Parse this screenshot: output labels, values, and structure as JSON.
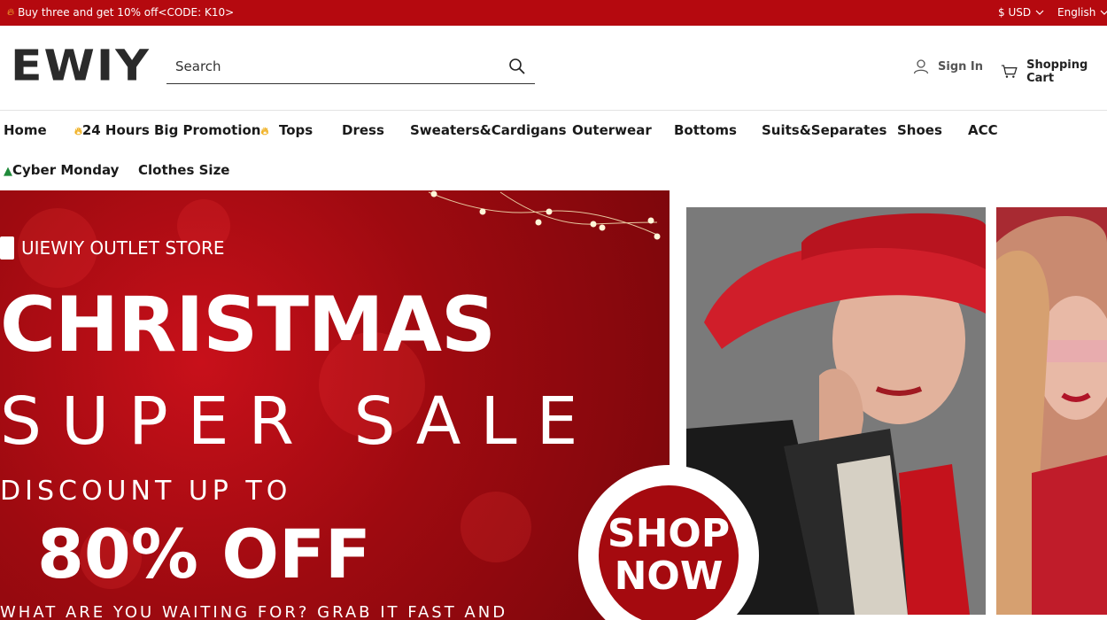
{
  "topbar": {
    "promo_text": "Buy three and get 10% off<CODE: K10>",
    "currency": "$ USD",
    "language": "English"
  },
  "header": {
    "logo": "EWIY",
    "search_placeholder": "Search",
    "sign_in": "Sign In",
    "cart": "Shopping Cart"
  },
  "nav": {
    "row1": [
      "Home",
      "24 Hours Big Promotion",
      "Tops",
      "Dress",
      "Sweaters&Cardigans",
      "Outerwear",
      "Bottoms",
      "Suits&Separates",
      "Shoes",
      "ACC"
    ],
    "row2": [
      "Cyber Monday",
      "Clothes Size"
    ]
  },
  "banner": {
    "store_name": "UIEWIY OUTLET STORE",
    "headline_1": "CHRISTMAS",
    "headline_2": "SUPER SALE",
    "discount_line": "DISCOUNT UP TO",
    "discount_value": "80% OFF",
    "tagline": "WHAT ARE YOU WAITING FOR? GRAB IT FAST AND",
    "cta_line_1": "SHOP",
    "cta_line_2": "NOW"
  },
  "colors": {
    "brand_red": "#b5090f",
    "banner_red": "#9e0a10",
    "text_dark": "#1a1a1a"
  },
  "icons": [
    "flame-icon",
    "chevron-down-icon",
    "search-icon",
    "user-icon",
    "cart-icon",
    "shopping-bag-icon",
    "christmas-tree-icon"
  ]
}
